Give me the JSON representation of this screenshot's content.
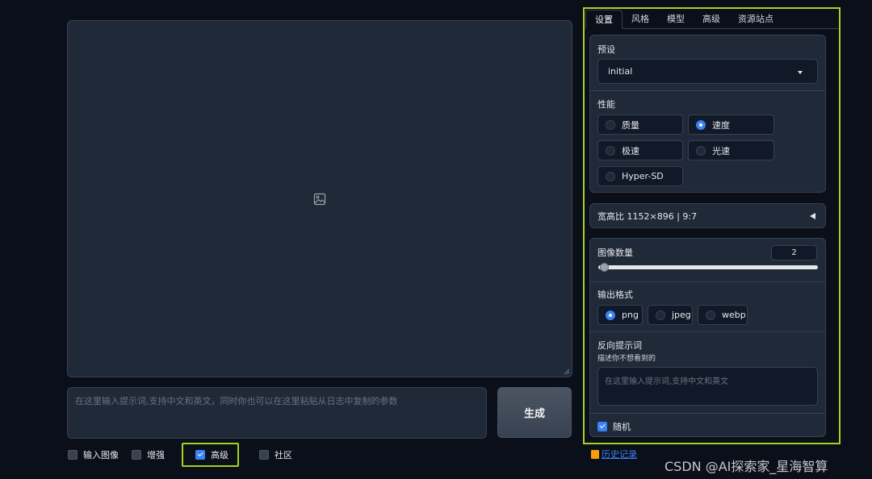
{
  "prompt": {
    "placeholder": "在这里输入提示词,支持中文和英文，同时你也可以在这里粘贴从日志中复制的参数"
  },
  "generate_label": "生成",
  "checkboxes": [
    {
      "label": "输入图像",
      "checked": false
    },
    {
      "label": "增强",
      "checked": false
    },
    {
      "label": "高级",
      "checked": true
    },
    {
      "label": "社区",
      "checked": false
    }
  ],
  "tabs": [
    "设置",
    "风格",
    "模型",
    "高级",
    "资源站点"
  ],
  "preset": {
    "label": "预设",
    "value": "initial"
  },
  "performance": {
    "label": "性能",
    "options": [
      {
        "label": "质量",
        "selected": false
      },
      {
        "label": "速度",
        "selected": true
      },
      {
        "label": "极速",
        "selected": false
      },
      {
        "label": "光速",
        "selected": false
      },
      {
        "label": "Hyper-SD",
        "selected": false
      }
    ]
  },
  "aspect": {
    "text": "宽高比 1152×896 | 9:7"
  },
  "image_count": {
    "label": "图像数量",
    "value": "2"
  },
  "output_format": {
    "label": "输出格式",
    "options": [
      {
        "label": "png",
        "selected": true
      },
      {
        "label": "jpeg",
        "selected": false
      },
      {
        "label": "webp",
        "selected": false
      }
    ]
  },
  "negative": {
    "label": "反向提示词",
    "hint": "描述你不想看到的",
    "placeholder": "在这里输入提示词,支持中文和英文"
  },
  "random": {
    "label": "随机",
    "checked": true
  },
  "history_label": "历史记录",
  "watermark": "CSDN @AI探索家_星海智算",
  "colors": {
    "background": "#0b0f19",
    "panel": "#1f2937",
    "border": "#374151",
    "accent": "#3b82f6",
    "highlight": "#a3d322"
  }
}
